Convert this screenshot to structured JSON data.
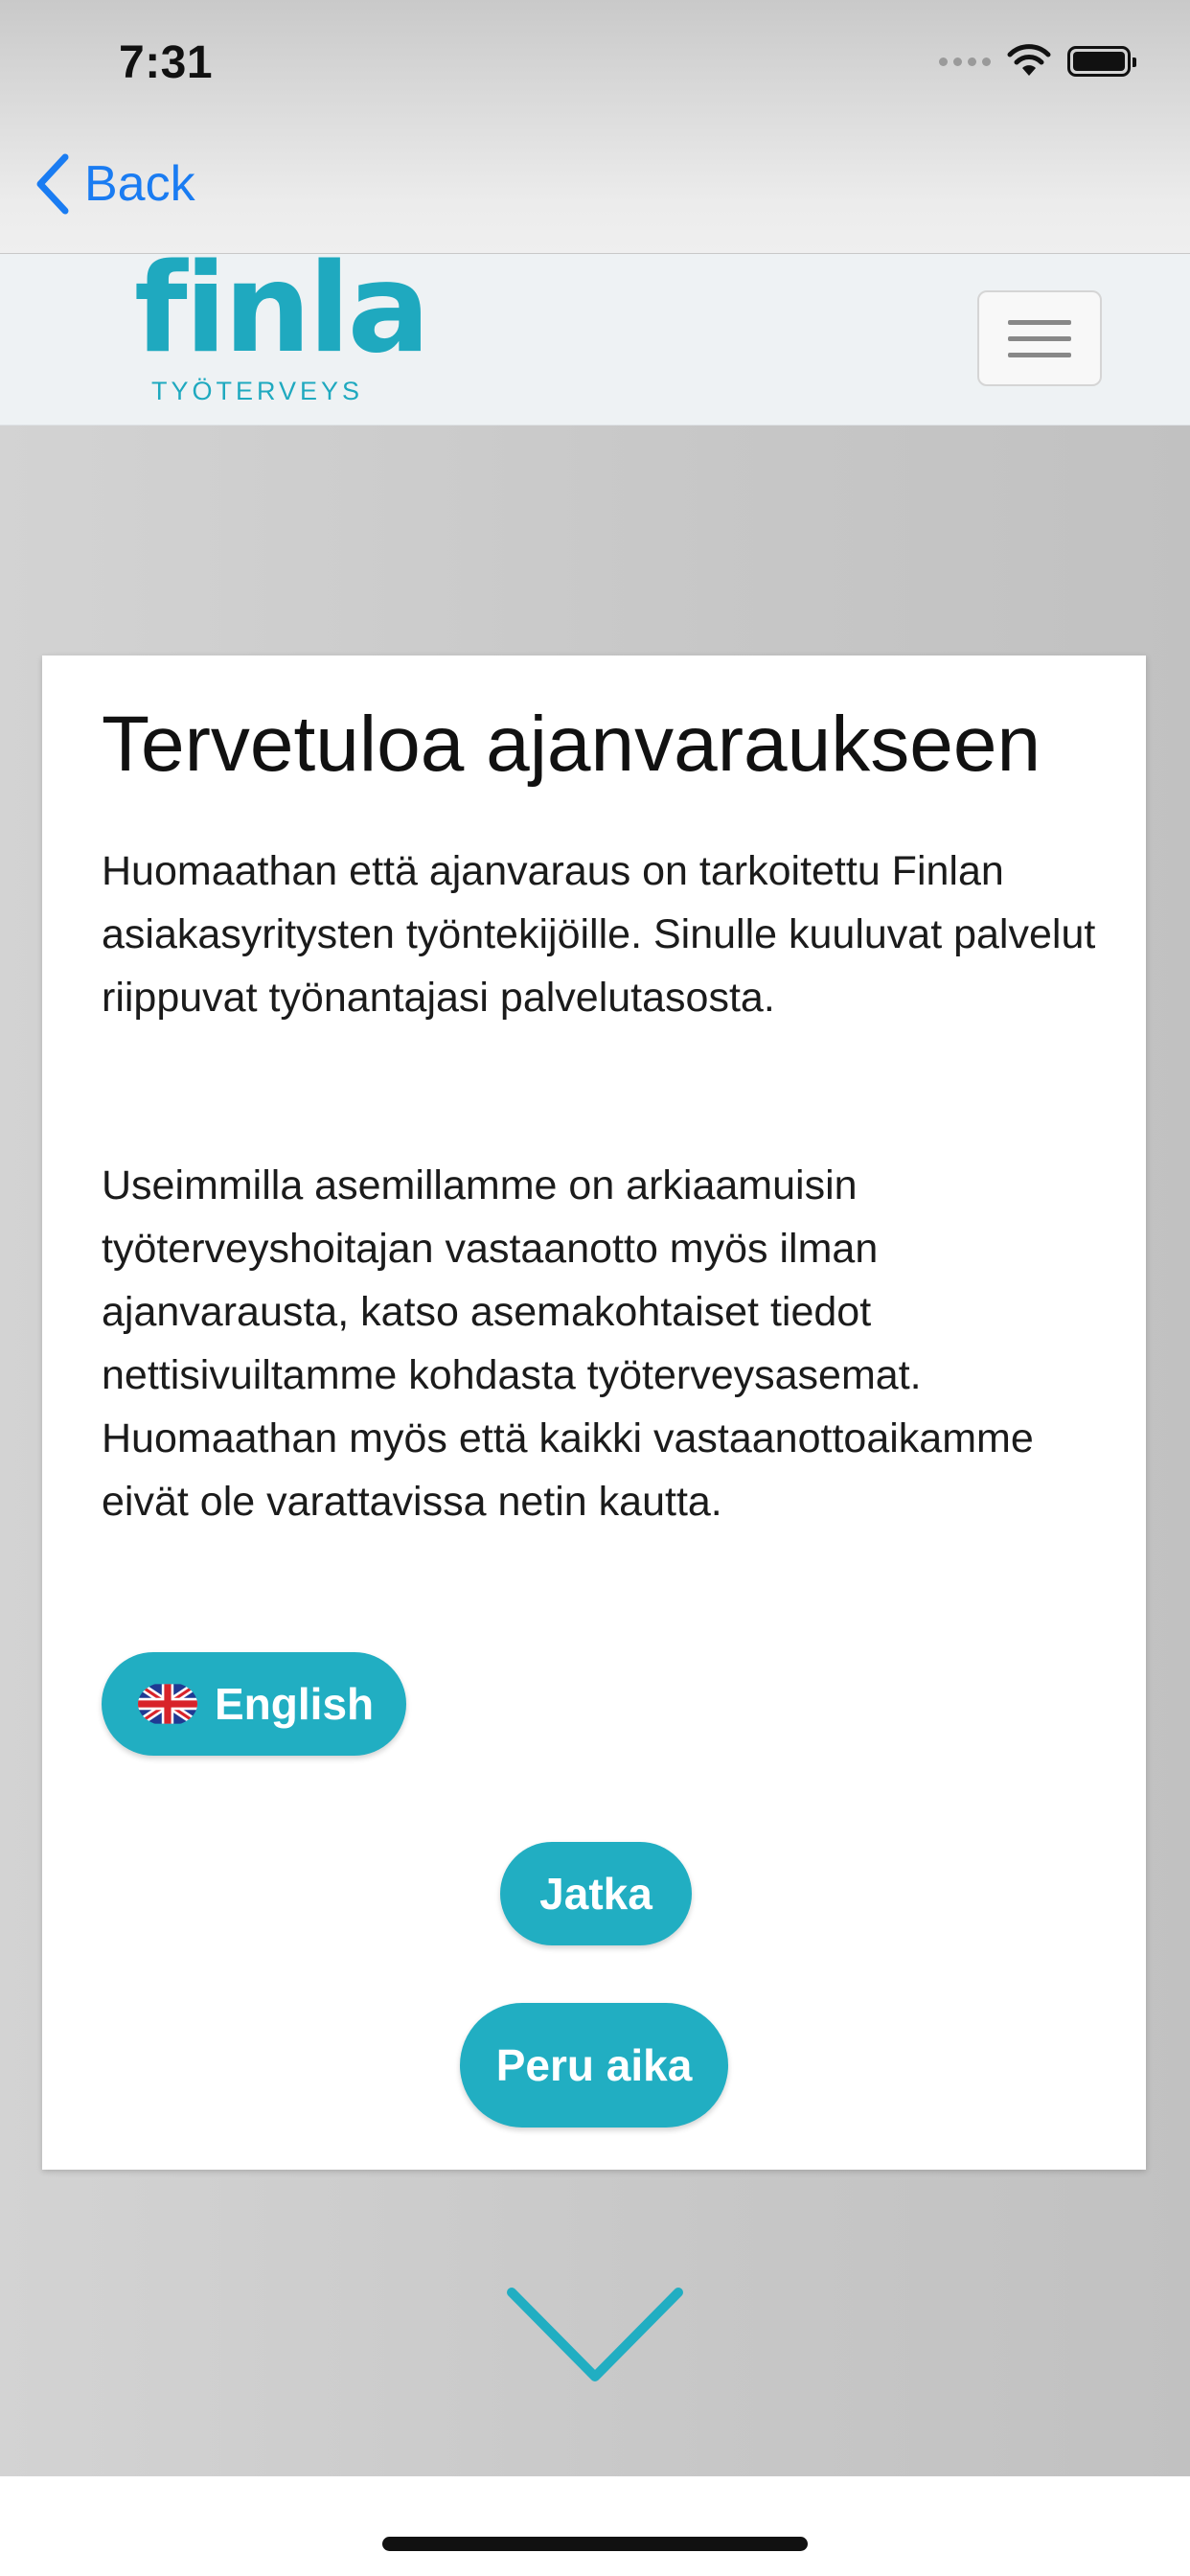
{
  "status_bar": {
    "time": "7:31",
    "icons": [
      "signal-icon",
      "wifi-icon",
      "battery-icon"
    ]
  },
  "nav": {
    "back_label": "Back",
    "back_icon": "chevron-left-icon",
    "accent_color": "#1a7cf2"
  },
  "header": {
    "logo_text": "finla",
    "logo_subtitle": "TYÖTERVEYS",
    "menu_icon": "hamburger-menu-icon",
    "brand_color": "#1fa9bf"
  },
  "card": {
    "title": "Tervetuloa ajanvaraukseen",
    "paragraph1": "Huomaathan että ajanvaraus on tarkoitettu Finlan asiakasyritysten työntekijöille. Sinulle kuuluvat palvelut riippuvat työnantajasi palvelutasosta.",
    "paragraph2": "Useimmilla asemillamme on arkiaamuisin työterveyshoitajan vastaanotto myös ilman ajanvarausta, katso asemakohtaiset tiedot nettisivuiltamme kohdasta työterveysasemat. Huomaathan myös että kaikki vastaanottoaikamme eivät ole varattavissa netin kautta.",
    "language_button_label": "English",
    "language_icon": "uk-flag-icon",
    "continue_label": "Jatka",
    "cancel_label": "Peru aika",
    "button_color": "#21aec2"
  },
  "scroll_icon": "chevron-down-icon"
}
